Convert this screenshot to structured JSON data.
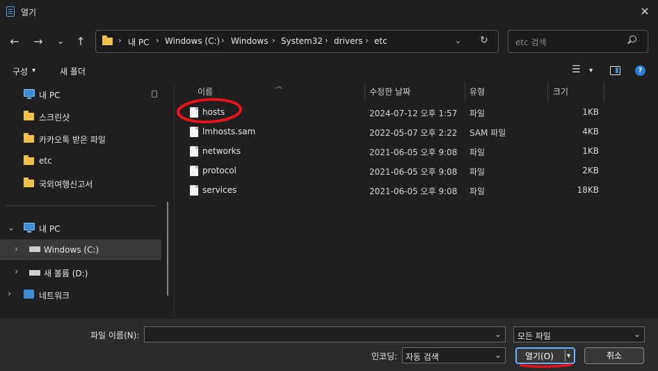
{
  "window": {
    "title": "열기",
    "close_glyph": "✕"
  },
  "nav": {
    "back": "←",
    "forward": "→",
    "recent": "⌄",
    "up": "↑"
  },
  "address": {
    "crumbs": [
      "내 PC",
      "Windows (C:)",
      "Windows",
      "System32",
      "drivers",
      "etc"
    ],
    "separator": "›",
    "dropdown_glyph": "⌄",
    "refresh_glyph": "↻"
  },
  "search": {
    "placeholder": "etc 검색"
  },
  "toolbar": {
    "organize": "구성",
    "new_folder": "새 폴더",
    "caret": "▾",
    "view_glyph": "☰",
    "help_glyph": "?"
  },
  "navpane": {
    "quick": [
      {
        "label": "내 PC",
        "icon": "pc-icon"
      },
      {
        "label": "스크린샷",
        "icon": "folder-icon"
      },
      {
        "label": "카카오톡 받은 파일",
        "icon": "folder-icon"
      },
      {
        "label": "etc",
        "icon": "folder-icon"
      },
      {
        "label": "국외여행신고서",
        "icon": "folder-icon"
      }
    ],
    "tree": [
      {
        "label": "내 PC",
        "icon": "pc-icon",
        "chevron": "⌄"
      },
      {
        "label": "Windows (C:)",
        "icon": "drive-icon",
        "chevron": "›"
      },
      {
        "label": "새 볼륨 (D:)",
        "icon": "drive-icon",
        "chevron": "›"
      },
      {
        "label": "네트워크",
        "icon": "network-icon",
        "chevron": "›"
      }
    ]
  },
  "columns": {
    "name": "이름",
    "modified": "수정한 날짜",
    "type": "유형",
    "size": "크기"
  },
  "files": [
    {
      "name": "hosts",
      "modified": "2024-07-12 오후 1:57",
      "type": "파일",
      "size": "1KB"
    },
    {
      "name": "lmhosts.sam",
      "modified": "2022-05-07 오후 2:22",
      "type": "SAM 파일",
      "size": "4KB"
    },
    {
      "name": "networks",
      "modified": "2021-06-05 오후 9:08",
      "type": "파일",
      "size": "1KB"
    },
    {
      "name": "protocol",
      "modified": "2021-06-05 오후 9:08",
      "type": "파일",
      "size": "2KB"
    },
    {
      "name": "services",
      "modified": "2021-06-05 오후 9:08",
      "type": "파일",
      "size": "18KB"
    }
  ],
  "bottom": {
    "filename_label": "파일 이름(N):",
    "filename_value": "",
    "filter_value": "모든 파일",
    "encoding_label": "인코딩:",
    "encoding_value": "자동 검색",
    "open_button": "열기(O)",
    "cancel_button": "취소",
    "dd_glyph": "⌄",
    "split_glyph": "▾"
  },
  "colors": {
    "annotation_red": "#e8141b",
    "folder": "#f0c24b",
    "accent": "#3b8fd6"
  }
}
